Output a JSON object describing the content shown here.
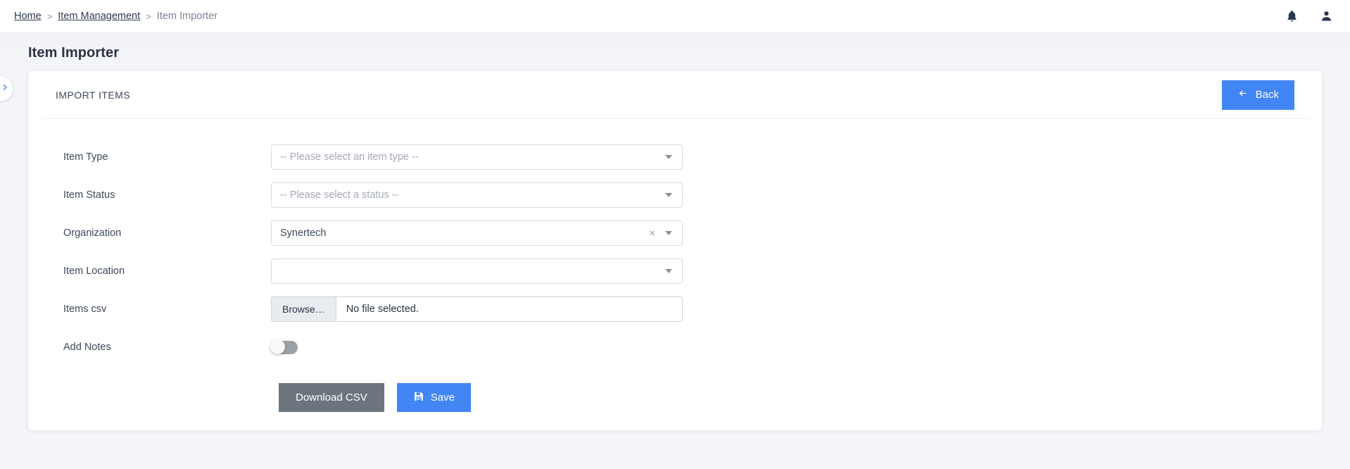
{
  "navbar": {
    "breadcrumb": {
      "home": "Home",
      "sep1": ">",
      "section": "Item Management",
      "sep2": ">",
      "current": "Item Importer"
    },
    "notifications_icon": "bell-icon",
    "user_icon": "user-icon"
  },
  "page": {
    "title": "Item Importer",
    "sidebar_toggle_icon": "chevron-right-icon"
  },
  "card": {
    "header_title": "IMPORT ITEMS",
    "back_label": "Back",
    "back_icon": "arrow-left-icon"
  },
  "form": {
    "item_type": {
      "label": "Item Type",
      "placeholder": "-- Please select an item type --",
      "value": ""
    },
    "item_status": {
      "label": "Item Status",
      "placeholder": "-- Please select a status --",
      "value": ""
    },
    "organization": {
      "label": "Organization",
      "value": "Synertech",
      "clear_icon": "close-icon"
    },
    "item_location": {
      "label": "Item Location",
      "value": ""
    },
    "items_csv": {
      "label": "Items csv",
      "browse_label": "Browse…",
      "file_status": "No file selected."
    },
    "add_notes": {
      "label": "Add Notes",
      "state": "off"
    }
  },
  "actions": {
    "download_csv_label": "Download CSV",
    "save_label": "Save",
    "save_icon": "floppy-disk-icon"
  },
  "colors": {
    "primary": "#4285f4",
    "secondary": "#6c757d",
    "page_bg": "#f4f5f9",
    "text": "#3d4759"
  }
}
